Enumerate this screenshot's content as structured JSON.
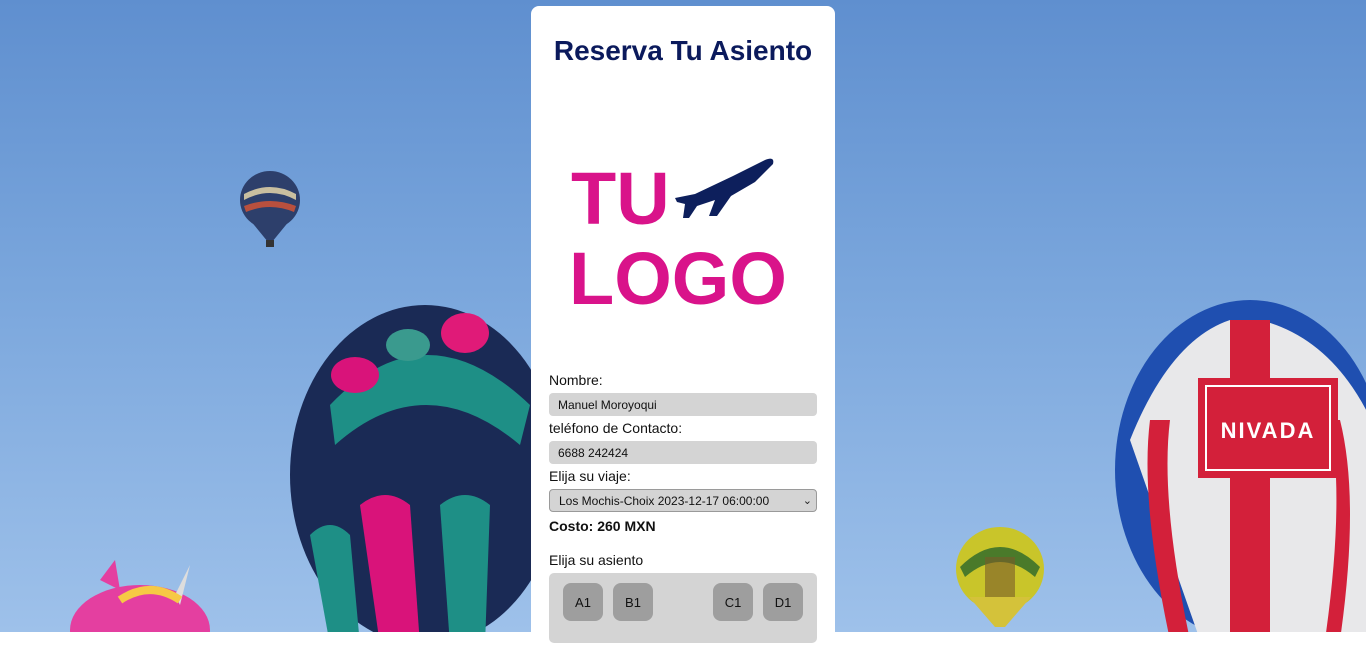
{
  "page": {
    "title": "Reserva Tu Asiento"
  },
  "logo": {
    "line1": "TU",
    "line2": "LOGO",
    "icon": "airplane-icon"
  },
  "form": {
    "name_label": "Nombre:",
    "name_value": "Manuel Moroyoqui",
    "phone_label": "teléfono de Contacto:",
    "phone_value": "6688 242424",
    "trip_label": "Elija su viaje:",
    "trip_selected": "Los Mochis-Choix 2023-12-17 06:00:00",
    "cost": "Costo: 260 MXN",
    "seat_label": "Elija su asiento",
    "seats": [
      "A1",
      "B1",
      "C1",
      "D1"
    ]
  },
  "background": {
    "balloon_banner": "NIVADA"
  },
  "colors": {
    "title": "#0b1a5c",
    "logo_pink": "#d9138a",
    "logo_navy": "#0d1f5c",
    "field_bg": "#d4d4d4",
    "seat_bg": "#9e9e9e"
  }
}
